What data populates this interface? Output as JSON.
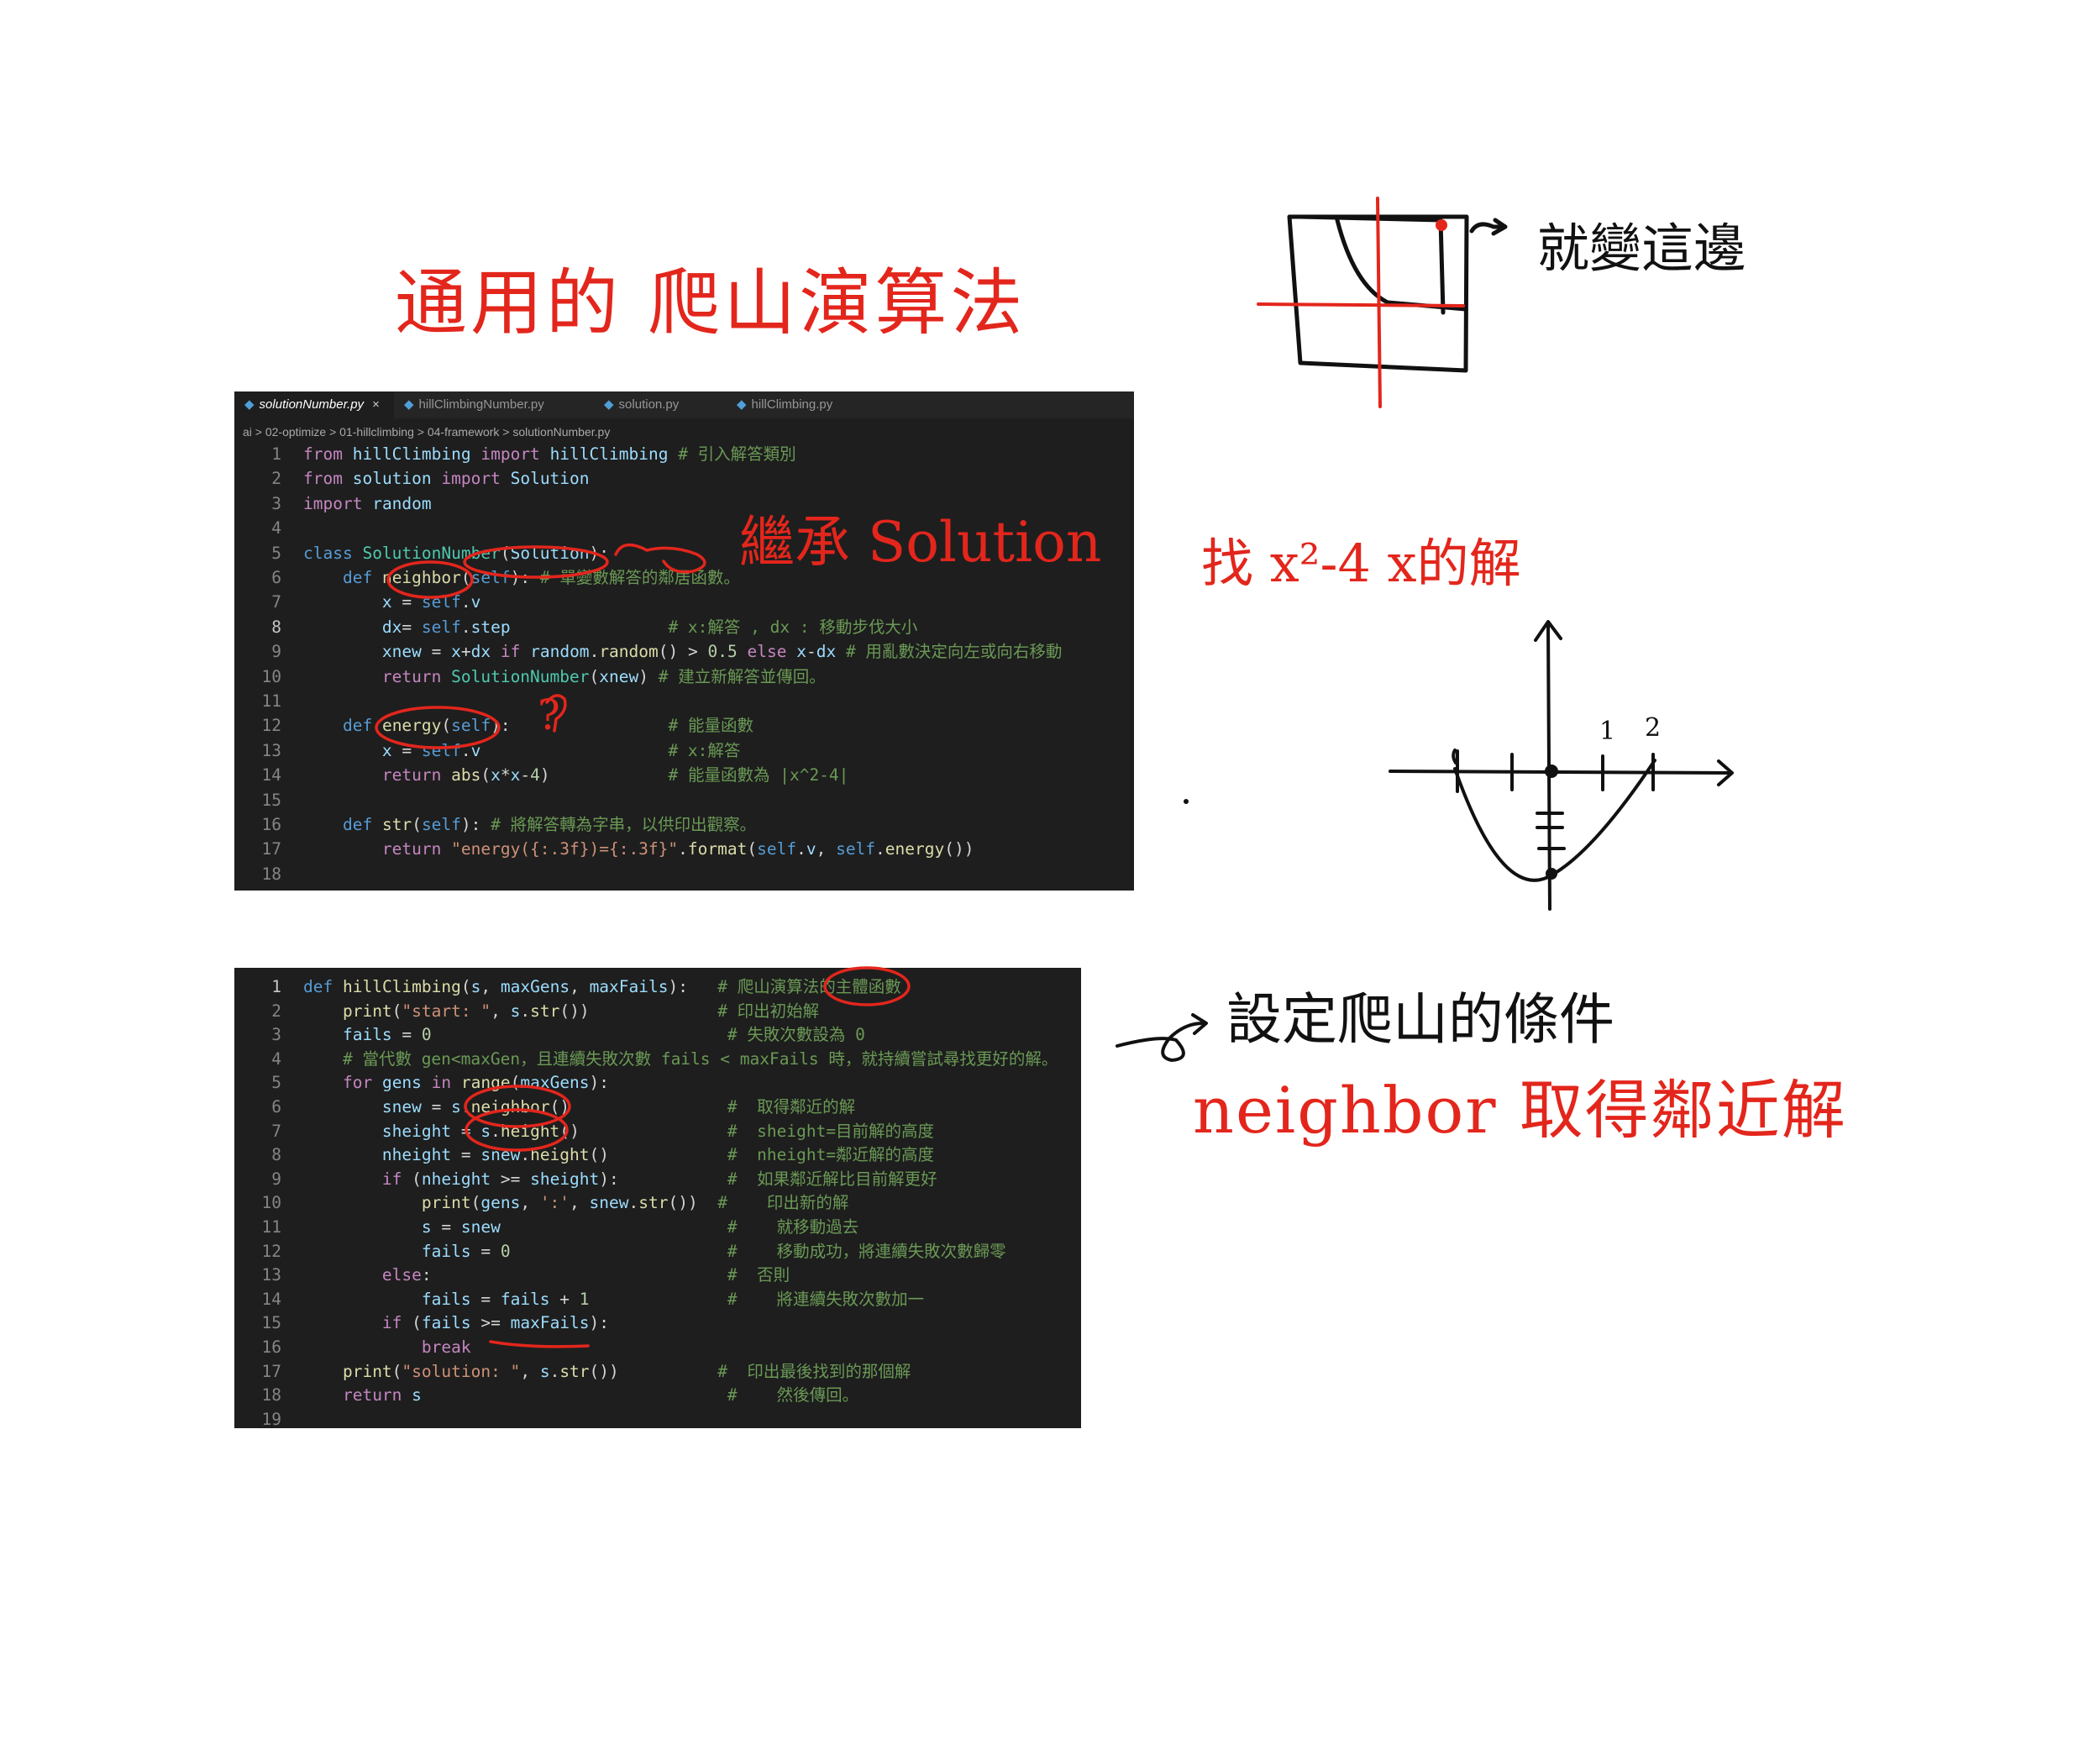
{
  "notes": {
    "title": "通用的 爬山演算法",
    "inherit": "繼承 Solution",
    "question_mark": "?",
    "changes_here": "就變這邊",
    "find_solution": "找 x²-4  x的解",
    "set_conditions": "設定爬山的條件",
    "neighbor_note": "neighbor 取得鄰近解",
    "parabola_ticks": [
      "1",
      "2"
    ]
  },
  "editor1": {
    "tabs": [
      {
        "label": "solutionNumber.py",
        "active": true,
        "close": "×"
      },
      {
        "label": "hillClimbingNumber.py",
        "active": false
      },
      {
        "label": "solution.py",
        "active": false
      },
      {
        "label": "hillClimbing.py",
        "active": false
      }
    ],
    "breadcrumb": "ai > 02-optimize > 01-hillclimbing > 04-framework > solutionNumber.py",
    "lines": [
      {
        "n": "1",
        "code": "from hillClimbing import hillClimbing # 引入解答類別"
      },
      {
        "n": "2",
        "code": "from solution import Solution"
      },
      {
        "n": "3",
        "code": "import random"
      },
      {
        "n": "4",
        "code": ""
      },
      {
        "n": "5",
        "code": "class SolutionNumber(Solution):"
      },
      {
        "n": "6",
        "code": "    def neighbor(self): # 單變數解答的鄰居函數。"
      },
      {
        "n": "7",
        "code": "        x = self.v"
      },
      {
        "n": "8",
        "code": "        dx= self.step                # x:解答 , dx : 移動步伐大小"
      },
      {
        "n": "9",
        "code": "        xnew = x+dx if random.random() > 0.5 else x-dx # 用亂數決定向左或向右移動"
      },
      {
        "n": "10",
        "code": "        return SolutionNumber(xnew) # 建立新解答並傳回。"
      },
      {
        "n": "11",
        "code": ""
      },
      {
        "n": "12",
        "code": "    def energy(self):                # 能量函數"
      },
      {
        "n": "13",
        "code": "        x = self.v                   # x:解答"
      },
      {
        "n": "14",
        "code": "        return abs(x*x-4)            # 能量函數為 |x^2-4|"
      },
      {
        "n": "15",
        "code": ""
      },
      {
        "n": "16",
        "code": "    def str(self): # 將解答轉為字串，以供印出觀察。"
      },
      {
        "n": "17",
        "code": "        return \"energy({:.3f})={:.3f}\".format(self.v, self.energy())"
      },
      {
        "n": "18",
        "code": ""
      }
    ]
  },
  "editor2": {
    "lines": [
      {
        "n": "1",
        "code": "def hillClimbing(s, maxGens, maxFails):   # 爬山演算法的主體函數"
      },
      {
        "n": "2",
        "code": "    print(\"start: \", s.str())             # 印出初始解"
      },
      {
        "n": "3",
        "code": "    fails = 0                              # 失敗次數設為 0"
      },
      {
        "n": "4",
        "code": "    # 當代數 gen<maxGen，且連續失敗次數 fails < maxFails 時，就持續嘗試尋找更好的解。"
      },
      {
        "n": "5",
        "code": "    for gens in range(maxGens):"
      },
      {
        "n": "6",
        "code": "        snew = s.neighbor()                #  取得鄰近的解"
      },
      {
        "n": "7",
        "code": "        sheight = s.height()               #  sheight=目前解的高度"
      },
      {
        "n": "8",
        "code": "        nheight = snew.height()            #  nheight=鄰近解的高度"
      },
      {
        "n": "9",
        "code": "        if (nheight >= sheight):           #  如果鄰近解比目前解更好"
      },
      {
        "n": "10",
        "code": "            print(gens, ':', snew.str())  #    印出新的解"
      },
      {
        "n": "11",
        "code": "            s = snew                       #    就移動過去"
      },
      {
        "n": "12",
        "code": "            fails = 0                      #    移動成功，將連續失敗次數歸零"
      },
      {
        "n": "13",
        "code": "        else:                              #  否則"
      },
      {
        "n": "14",
        "code": "            fails = fails + 1              #    將連續失敗次數加一"
      },
      {
        "n": "15",
        "code": "        if (fails >= maxFails):"
      },
      {
        "n": "16",
        "code": "            break"
      },
      {
        "n": "17",
        "code": "    print(\"solution: \", s.str())          #  印出最後找到的那個解"
      },
      {
        "n": "18",
        "code": "    return s                               #    然後傳回。"
      },
      {
        "n": "19",
        "code": ""
      }
    ]
  },
  "colors": {
    "ink_red": "#e3261c",
    "ink_black": "#111111",
    "editor_bg": "#1e1e1e",
    "tab_bg": "#252526"
  }
}
